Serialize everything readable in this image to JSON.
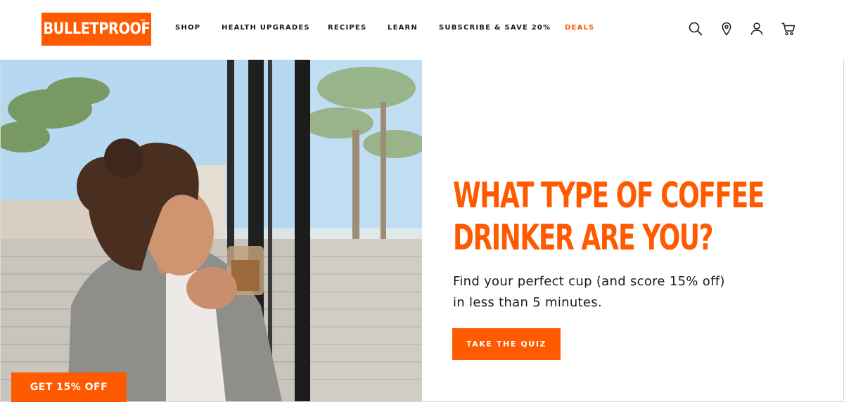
{
  "brand": {
    "logo_text": "BULLETPROOF",
    "trademark": "™",
    "accent_color": "#ff5a00"
  },
  "nav": {
    "items": [
      {
        "label": "SHOP"
      },
      {
        "label": "HEALTH UPGRADES"
      },
      {
        "label": "RECIPES"
      },
      {
        "label": "LEARN"
      },
      {
        "label": "SUBSCRIBE & SAVE 20%"
      },
      {
        "label": "DEALS"
      }
    ]
  },
  "header_icons": [
    "search-icon",
    "location-pin-icon",
    "account-icon",
    "cart-icon"
  ],
  "hero": {
    "image_alt": "Woman with curly hair in a gray cardigan holding a glass mug of coffee, eyes closed in the sunlight",
    "title_line1": "WHAT TYPE OF COFFEE",
    "title_line2": "DRINKER ARE YOU?",
    "subtitle_line1": "Find your perfect cup (and score 15% off)",
    "subtitle_line2": "in less than 5 minutes.",
    "cta_label": "TAKE THE QUIZ"
  },
  "promo": {
    "label": "GET 15% OFF"
  }
}
